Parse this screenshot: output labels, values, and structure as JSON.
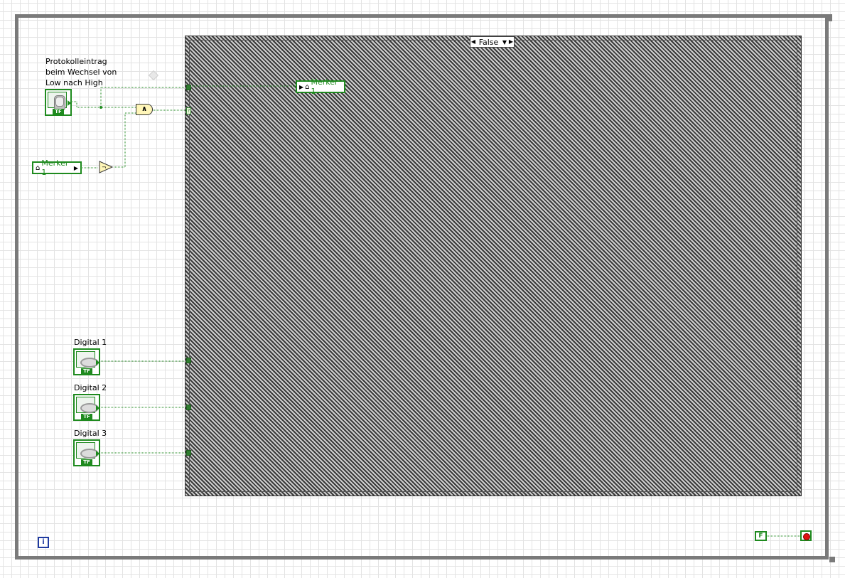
{
  "case_structure": {
    "selector_value": "False"
  },
  "controls": {
    "protokoll": {
      "label_lines": [
        "Protokolleintrag",
        "beim Wechsel von",
        "Low nach High"
      ],
      "tf": "TF"
    },
    "digital_1": {
      "label": "Digital 1",
      "tf": "TF"
    },
    "digital_2": {
      "label": "Digital 2",
      "tf": "TF"
    },
    "digital_3": {
      "label": "Digital 3",
      "tf": "TF"
    }
  },
  "local_variables": {
    "merker_read": {
      "name": "Merker 1"
    },
    "merker_write": {
      "name": "Merker 1"
    }
  },
  "functions": {
    "and": "∧",
    "not": "¬"
  },
  "iteration_terminal": {
    "symbol": "i"
  },
  "false_constant": {
    "value": "F"
  },
  "tunnel_selector_mark": "?",
  "colors": {
    "boolean_wire": "#1e8a1e",
    "loop_border": "#7a7a7a",
    "iteration": "#1f3aa0",
    "stop": "#e01010"
  }
}
